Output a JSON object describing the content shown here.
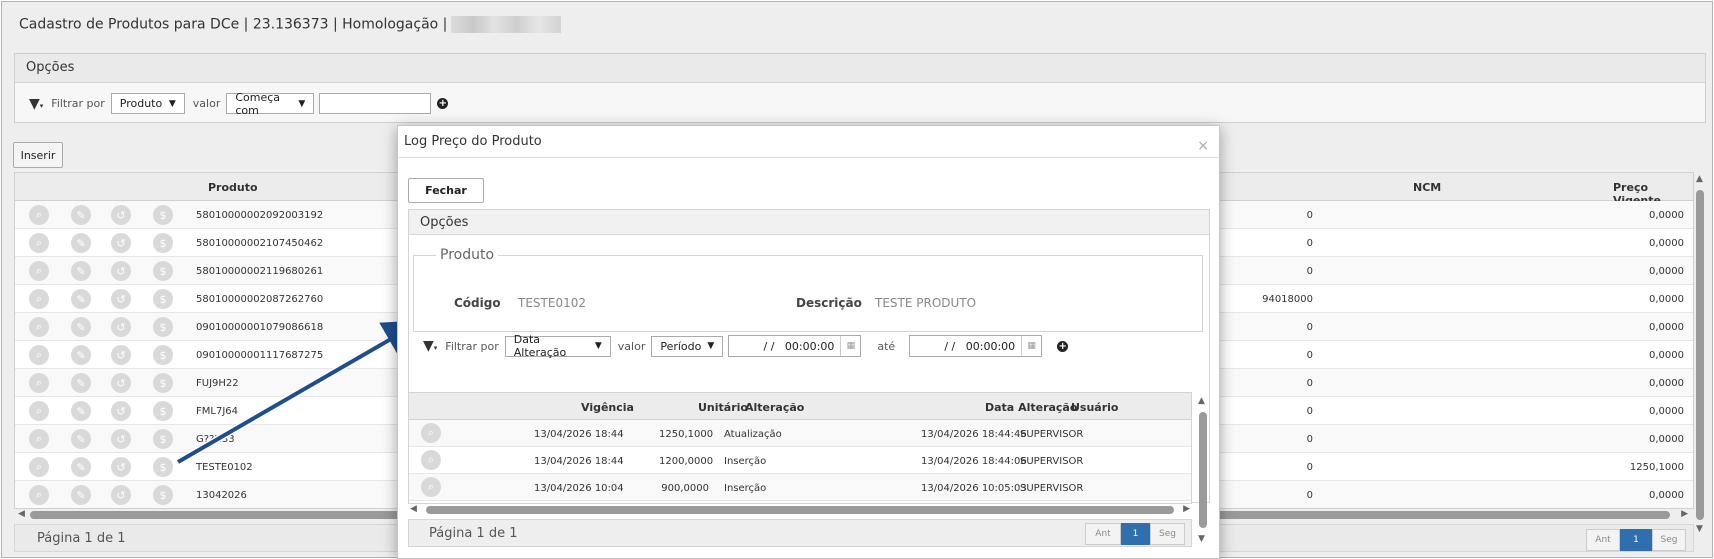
{
  "window": {
    "title": "Cadastro de Produtos para DCe | 23.136373 | Homologação |"
  },
  "options_panel": {
    "title": "Opções",
    "filter_label": "Filtrar por",
    "filter_field": "Produto",
    "value_label": "valor",
    "value_op": "Começa com",
    "value_input": ""
  },
  "insert_button": "Inserir",
  "main_grid": {
    "columns": {
      "produto": "Produto",
      "ncm": "NCM",
      "preco": "Preço Vigente"
    },
    "rows": [
      {
        "produto": "58010000002092003192",
        "ncm": "0",
        "preco": "0,0000"
      },
      {
        "produto": "58010000002107450462",
        "ncm": "0",
        "preco": "0,0000"
      },
      {
        "produto": "58010000002119680261",
        "ncm": "0",
        "preco": "0,0000"
      },
      {
        "produto": "58010000002087262760",
        "ncm": "94018000",
        "preco": "0,0000"
      },
      {
        "produto": "09010000001079086618",
        "ncm": "0",
        "preco": "0,0000"
      },
      {
        "produto": "09010000001117687275",
        "ncm": "0",
        "preco": "0,0000"
      },
      {
        "produto": "FUJ9H22",
        "ncm": "0",
        "preco": "0,0000"
      },
      {
        "produto": "FML7J64",
        "ncm": "0",
        "preco": "0,0000"
      },
      {
        "produto": "G??H33",
        "ncm": "0",
        "preco": "0,0000"
      },
      {
        "produto": "TESTE0102",
        "ncm": "0",
        "preco": "1250,1000"
      },
      {
        "produto": "13042026",
        "ncm": "0",
        "preco": "0,0000"
      }
    ],
    "pager_text": "Página 1 de 1",
    "pager": {
      "prev": "Ant",
      "page": "1",
      "next": "Seg"
    }
  },
  "modal": {
    "title": "Log Preço do Produto",
    "close_glyph": "×",
    "close_button": "Fechar",
    "options_title": "Opções",
    "product_legend": "Produto",
    "code_label": "Código",
    "code_value": "TESTE0102",
    "desc_label": "Descrição",
    "desc_value": "TESTE PRODUTO",
    "filter_label": "Filtrar por",
    "filter_field": "Data Alteração",
    "value_label": "valor",
    "value_op": "Período",
    "date_from": "/ /   00:00:00",
    "until_label": "até",
    "date_to": "/ /   00:00:00",
    "grid": {
      "columns": {
        "vigencia": "Vigência",
        "unitario": "Unitário",
        "alteracao": "Alteração",
        "data_alteracao": "Data Alteração",
        "usuario": "Usuário"
      },
      "rows": [
        {
          "vigencia": "13/04/2026 18:44",
          "unitario": "1250,1000",
          "alteracao": "Atualização",
          "data_alteracao": "13/04/2026 18:44:46",
          "usuario": "SUPERVISOR"
        },
        {
          "vigencia": "13/04/2026 18:44",
          "unitario": "1200,0000",
          "alteracao": "Inserção",
          "data_alteracao": "13/04/2026 18:44:06",
          "usuario": "SUPERVISOR"
        },
        {
          "vigencia": "13/04/2026 10:04",
          "unitario": "900,0000",
          "alteracao": "Inserção",
          "data_alteracao": "13/04/2026 10:05:03",
          "usuario": "SUPERVISOR"
        }
      ]
    },
    "pager_text": "Página 1 de 1",
    "pager": {
      "prev": "Ant",
      "page": "1",
      "next": "Seg"
    }
  },
  "colors": {
    "accent": "#2f6fad",
    "arrow": "#1f4e8c"
  }
}
